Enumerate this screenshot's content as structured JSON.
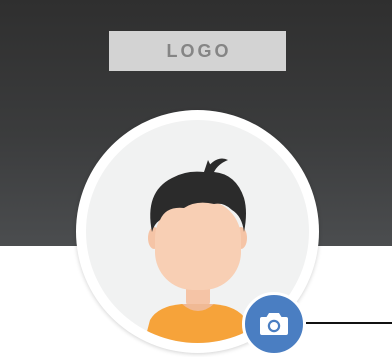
{
  "header": {
    "logo_text": "LOGO",
    "gradient_top": "#2f2f2f",
    "gradient_bottom": "#4b4d4f"
  },
  "avatar": {
    "icon": "user-avatar-illustration",
    "background": "#f1f2f2",
    "hair_color": "#2b2b2b",
    "skin_color": "#f8cfb4",
    "shirt_color": "#f6a33a"
  },
  "camera_button": {
    "icon": "camera-icon",
    "color": "#4a7ec2"
  }
}
